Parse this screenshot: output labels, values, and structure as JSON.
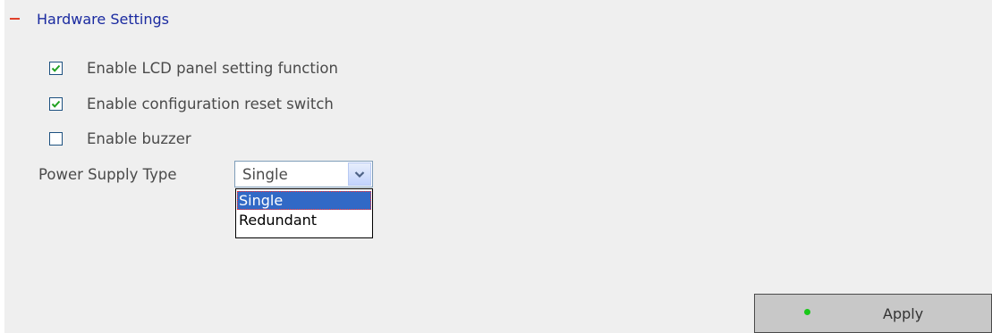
{
  "section": {
    "title": "Hardware Settings",
    "icon": "collapse-minus-icon"
  },
  "options": [
    {
      "label": "Enable LCD panel setting function",
      "checked": true
    },
    {
      "label": "Enable configuration reset switch",
      "checked": true
    },
    {
      "label": "Enable buzzer",
      "checked": false
    }
  ],
  "power_supply": {
    "label": "Power Supply Type",
    "selected": "Single",
    "options": [
      "Single",
      "Redundant"
    ],
    "highlighted_option": "Single"
  },
  "apply_button": {
    "label": "Apply",
    "icon": "green-dot-icon"
  },
  "colors": {
    "panel_bg": "#efefef",
    "header_text": "#1a2aa0",
    "collapse_icon": "#e0402a",
    "checkbox_border": "#1d5180",
    "checkmark": "#21a121",
    "selected_option_bg": "#3169c6",
    "apply_bg": "#c8c8c8",
    "apply_dot": "#19c819"
  }
}
